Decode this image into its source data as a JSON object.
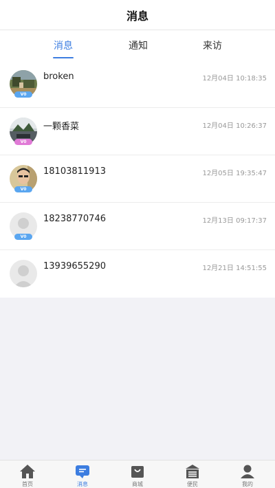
{
  "header": {
    "title": "消息"
  },
  "tabs": [
    {
      "label": "消息",
      "active": true
    },
    {
      "label": "通知",
      "active": false
    },
    {
      "label": "来访",
      "active": false
    }
  ],
  "messages": [
    {
      "name": "broken",
      "time": "12月04日 10:18:35",
      "badge": "V0",
      "badge_color": "#5aa6f0",
      "avatar": "photo-outdoor"
    },
    {
      "name": "一颗香菜",
      "time": "12月04日 10:26:37",
      "badge": "V0",
      "badge_color": "#e07ad6",
      "avatar": "photo-street"
    },
    {
      "name": "18103811913",
      "time": "12月05日 19:35:47",
      "badge": "V0",
      "badge_color": "#5aa6f0",
      "avatar": "photo-person"
    },
    {
      "name": "18238770746",
      "time": "12月13日 09:17:37",
      "badge": "V0",
      "badge_color": "#5aa6f0",
      "avatar": "default-avatar"
    },
    {
      "name": "13939655290",
      "time": "12月21日 14:51:55",
      "badge": "",
      "badge_color": "",
      "avatar": "default-avatar"
    }
  ],
  "tabbar": [
    {
      "label": "首页",
      "icon": "home-icon",
      "active": false
    },
    {
      "label": "消息",
      "icon": "message-icon",
      "active": true
    },
    {
      "label": "商城",
      "icon": "shop-bag-icon",
      "active": false
    },
    {
      "label": "便民",
      "icon": "service-icon",
      "active": false
    },
    {
      "label": "我的",
      "icon": "profile-icon",
      "active": false
    }
  ],
  "colors": {
    "accent": "#3c7de0",
    "background": "#f2f2f6"
  }
}
